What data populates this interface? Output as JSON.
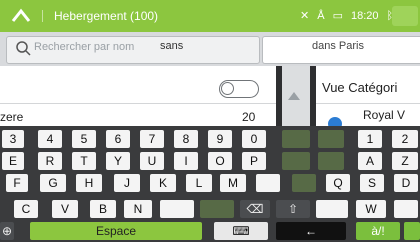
{
  "topbar": {
    "title": "Hebergement (100)",
    "time": "18:20",
    "icons": [
      "back-arrow-icon",
      "signal-icon",
      "gps-icon",
      "battery-icon",
      "bluetooth-icon"
    ]
  },
  "search": {
    "placeholder": "Rechercher par nom",
    "typed_fragment": "sans",
    "address_chip": "dans Paris"
  },
  "list": {
    "toggle_on": false,
    "item_name": "zere",
    "item_distance": "20"
  },
  "category_panel": {
    "header": "Vue Catégori",
    "item": "Royal V"
  },
  "keyboard": {
    "row1": [
      "3",
      "4",
      "5",
      "6",
      "7",
      "8",
      "9",
      "0",
      "",
      "",
      "1",
      "2"
    ],
    "row2": [
      "E",
      "R",
      "T",
      "Y",
      "U",
      "I",
      "O",
      "P",
      "",
      "",
      "A",
      "Z"
    ],
    "row3": [
      "F",
      "G",
      "H",
      "J",
      "K",
      "L",
      "M",
      "",
      "",
      "Q",
      "S",
      "D"
    ],
    "row4": [
      "C",
      "V",
      "B",
      "N",
      "",
      "",
      "",
      "W",
      ""
    ],
    "row5": {
      "globe": "globe-icon",
      "space": "Espace",
      "keyboard_icon": "keyboard-icon",
      "backspace_arrow": "←",
      "symbols": "à/!"
    },
    "shift_icon": "shift-icon"
  },
  "colors": {
    "accent": "#8cc63f",
    "dot": "#2b7cd3"
  }
}
